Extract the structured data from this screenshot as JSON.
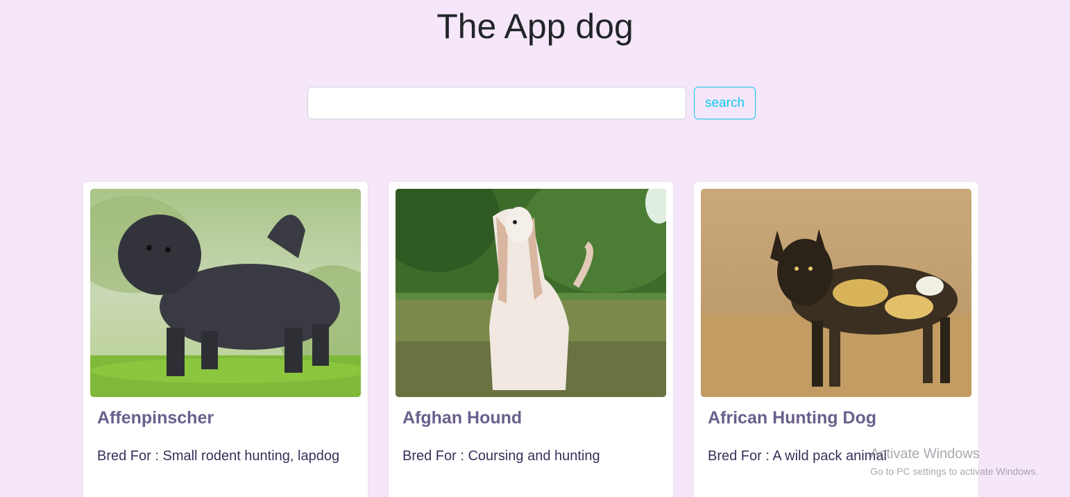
{
  "header": {
    "title": "The App dog"
  },
  "search": {
    "placeholder": "",
    "value": "",
    "button_label": "search"
  },
  "cards": [
    {
      "name": "Affenpinscher",
      "bred_for": "Bred For : Small rodent hunting, lapdog",
      "image_icon": "dog-photo-affenpinscher"
    },
    {
      "name": "Afghan Hound",
      "bred_for": "Bred For : Coursing and hunting",
      "image_icon": "dog-photo-afghan-hound"
    },
    {
      "name": "African Hunting Dog",
      "bred_for": "Bred For : A wild pack animal",
      "image_icon": "dog-photo-african-hunting-dog"
    }
  ],
  "watermark": {
    "title": "Activate Windows",
    "subtitle": "Go to PC settings to activate Windows."
  },
  "colors": {
    "background": "#f5e6f9",
    "accent": "#0dcaf0",
    "card_title": "#6a5f8c",
    "card_text": "#36305a"
  }
}
